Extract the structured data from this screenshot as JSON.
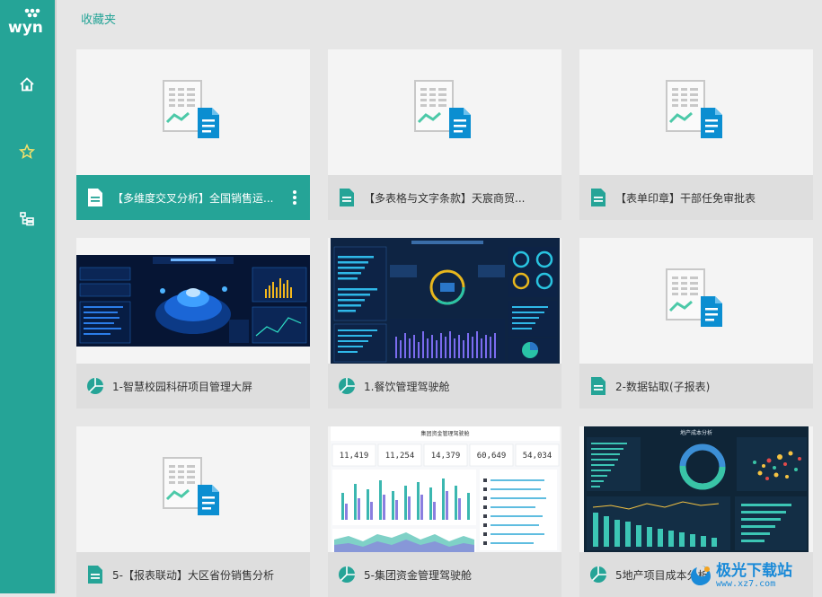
{
  "app": {
    "logo_text": "wyn",
    "accent": "#25a497"
  },
  "sidebar": {
    "items": [
      {
        "name": "home",
        "icon": "home-icon"
      },
      {
        "name": "favorites",
        "icon": "star-icon"
      },
      {
        "name": "catalog",
        "icon": "tree-icon"
      }
    ]
  },
  "page": {
    "title": "收藏夹"
  },
  "cards": [
    {
      "title": "【多维度交叉分析】全国销售运...",
      "type": "report",
      "thumbnail": "placeholder",
      "active": true
    },
    {
      "title": "【多表格与文字条款】天宸商贸...",
      "type": "report",
      "thumbnail": "placeholder",
      "active": false
    },
    {
      "title": "【表单印章】干部任免审批表",
      "type": "report",
      "thumbnail": "placeholder",
      "active": false
    },
    {
      "title": "1-智慧校园科研项目管理大屏",
      "type": "dashboard",
      "thumbnail": "dark-dashboard",
      "active": false
    },
    {
      "title": "1.餐饮管理驾驶舱",
      "type": "dashboard",
      "thumbnail": "restaurant-dashboard",
      "active": false
    },
    {
      "title": "2-数据钻取(子报表)",
      "type": "report",
      "thumbnail": "placeholder",
      "active": false
    },
    {
      "title": "5-【报表联动】大区省份销售分析",
      "type": "report",
      "thumbnail": "placeholder",
      "active": false
    },
    {
      "title": "5-集团资金管理驾驶舱",
      "type": "dashboard",
      "thumbnail": "finance-dashboard",
      "active": false
    },
    {
      "title": "5地产项目成本分析",
      "type": "dashboard",
      "thumbnail": "realestate-dashboard",
      "active": false
    }
  ],
  "thumbs": {
    "finance_title": "集团资金管理驾驶舱",
    "finance_kpis": [
      "11,419",
      "11,254",
      "14,379",
      "60,649",
      "54,034"
    ],
    "realestate_title": "地产成本分析"
  },
  "watermark": {
    "text": "极光下载站",
    "url": "www.xz7.com"
  }
}
